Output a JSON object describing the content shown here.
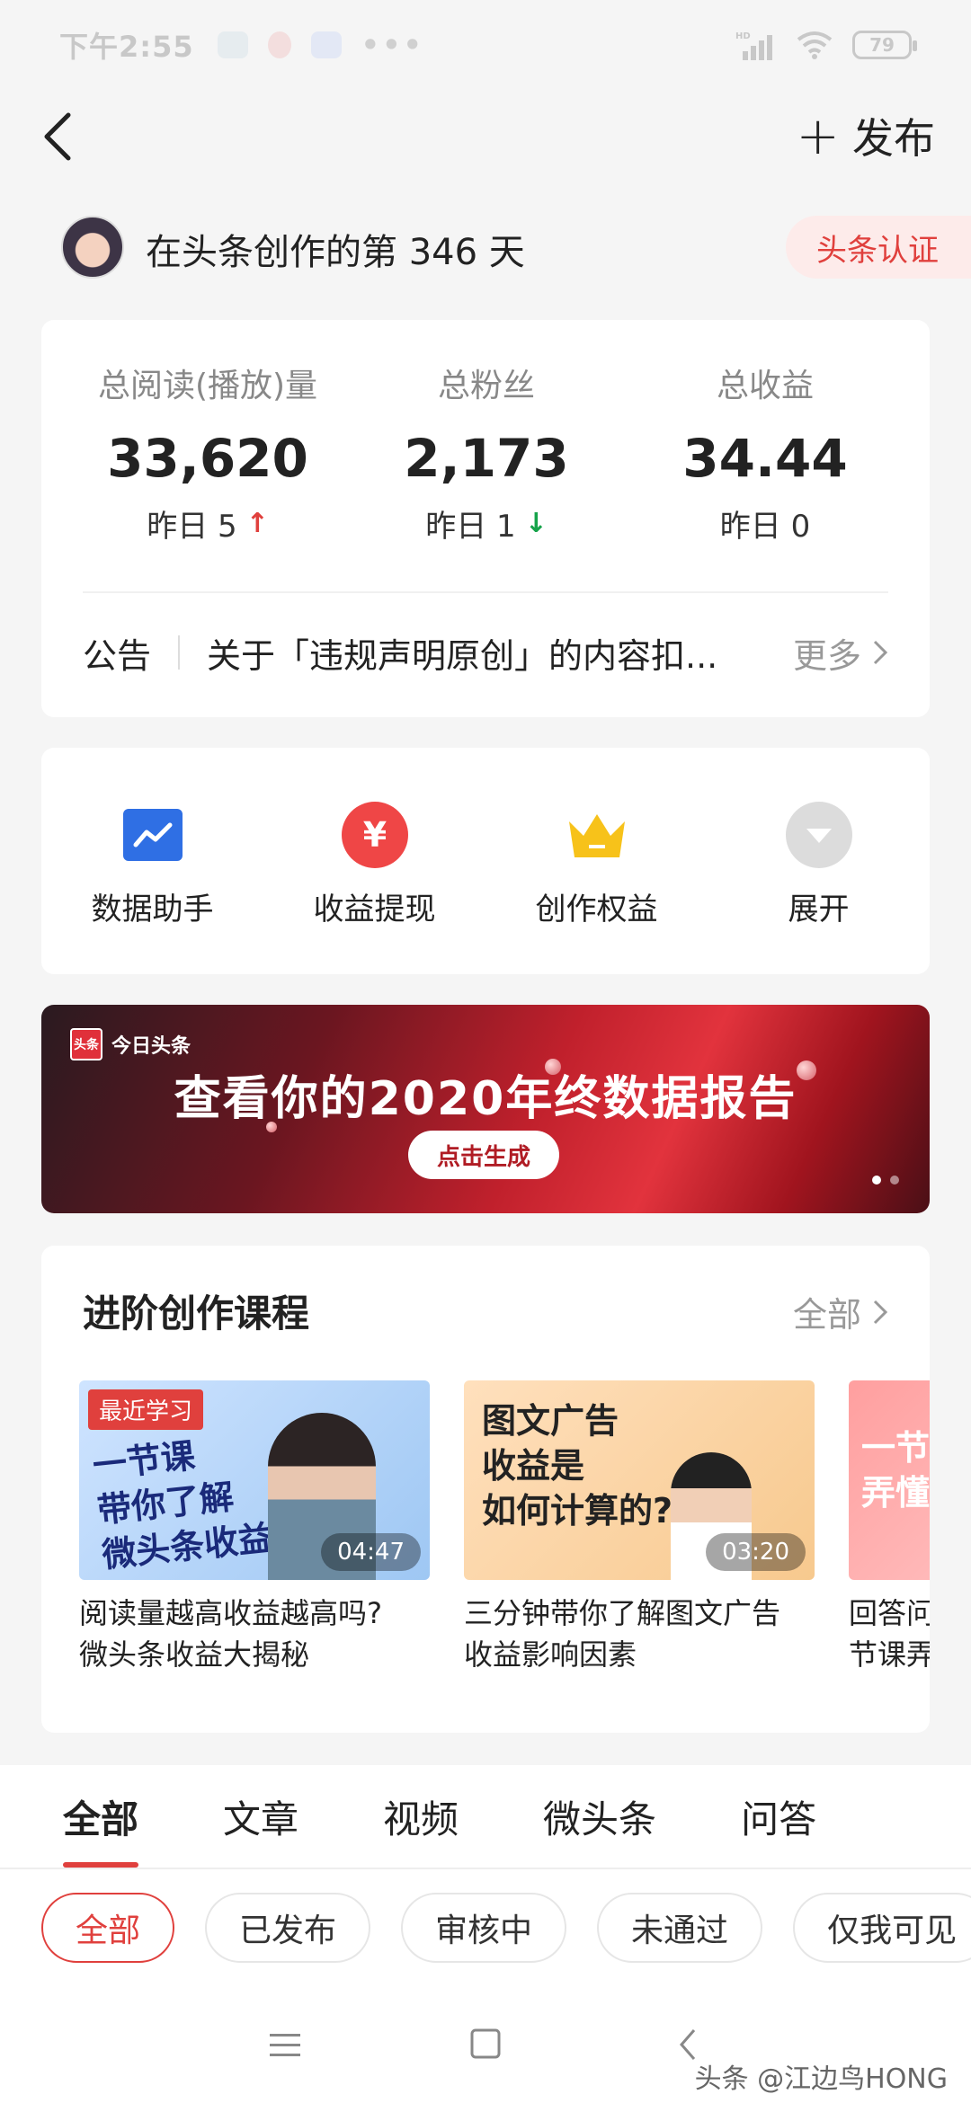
{
  "status_bar": {
    "time": "下午2:55",
    "battery": "79",
    "network": "HD"
  },
  "header": {
    "publish_label": "发布"
  },
  "profile": {
    "text": "在头条创作的第 346 天",
    "verify_label": "头条认证"
  },
  "stats": [
    {
      "label": "总阅读(播放)量",
      "value": "33,620",
      "sub": "昨日 5",
      "trend": "up"
    },
    {
      "label": "总粉丝",
      "value": "2,173",
      "sub": "昨日 1",
      "trend": "down"
    },
    {
      "label": "总收益",
      "value": "34.44",
      "sub": "昨日 0",
      "trend": "none"
    }
  ],
  "notice": {
    "tag": "公告",
    "text": "关于「违规声明原创」的内容扣...",
    "more": "更多"
  },
  "tools": [
    {
      "label": "数据助手",
      "icon": "chart-icon",
      "color": "#2f6fe4"
    },
    {
      "label": "收益提现",
      "icon": "yuan-icon",
      "color": "#ef4646"
    },
    {
      "label": "创作权益",
      "icon": "crown-icon",
      "color": "#f7c21a"
    },
    {
      "label": "展开",
      "icon": "expand-icon",
      "color": "#dcdcdc"
    }
  ],
  "banner": {
    "logo_text": "今日头条",
    "logo_box": "头条",
    "title": "查看你的2020年终数据报告",
    "cta": "点击生成"
  },
  "courses": {
    "title": "进阶创作课程",
    "all_label": "全部",
    "items": [
      {
        "badge": "最近学习",
        "thumb_text": "一节课\n带你了解\n微头条收益",
        "duration": "04:47",
        "caption_line1": "阅读量越高收益越高吗?",
        "caption_line2": "微头条收益大揭秘"
      },
      {
        "badge": "",
        "thumb_text": "图文广告\n收益是\n如何计算的?",
        "duration": "03:20",
        "caption_line1": "三分钟带你了解图文广告",
        "caption_line2": "收益影响因素"
      },
      {
        "badge": "",
        "thumb_text": "一节\n弄懂",
        "duration": "",
        "caption_line1": "回答问",
        "caption_line2": "节课弄"
      }
    ]
  },
  "tabs": [
    "全部",
    "文章",
    "视频",
    "微头条",
    "问答"
  ],
  "filters": [
    "全部",
    "已发布",
    "审核中",
    "未通过",
    "仅我可见"
  ],
  "watermark": "头条 @江边鸟HONG"
}
